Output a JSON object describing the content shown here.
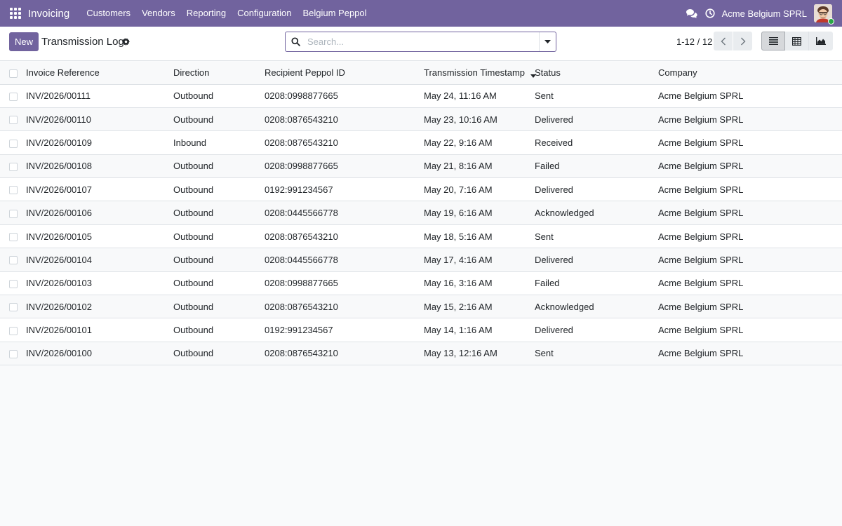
{
  "navbar": {
    "app_name": "Invoicing",
    "menu": [
      "Customers",
      "Vendors",
      "Reporting",
      "Configuration",
      "Belgium Peppol"
    ],
    "company": "Acme Belgium SPRL"
  },
  "control_panel": {
    "new_label": "New",
    "title": "Transmission Log",
    "search_placeholder": "Search...",
    "pager": "1-12 / 12"
  },
  "table": {
    "columns": [
      "Invoice Reference",
      "Direction",
      "Recipient Peppol ID",
      "Transmission Timestamp",
      "Status",
      "Company"
    ],
    "rows": [
      [
        "INV/2026/00111",
        "Outbound",
        "0208:0998877665",
        "May 24, 11:16 AM",
        "Sent",
        "Acme Belgium SPRL"
      ],
      [
        "INV/2026/00110",
        "Outbound",
        "0208:0876543210",
        "May 23, 10:16 AM",
        "Delivered",
        "Acme Belgium SPRL"
      ],
      [
        "INV/2026/00109",
        "Inbound",
        "0208:0876543210",
        "May 22, 9:16 AM",
        "Received",
        "Acme Belgium SPRL"
      ],
      [
        "INV/2026/00108",
        "Outbound",
        "0208:0998877665",
        "May 21, 8:16 AM",
        "Failed",
        "Acme Belgium SPRL"
      ],
      [
        "INV/2026/00107",
        "Outbound",
        "0192:991234567",
        "May 20, 7:16 AM",
        "Delivered",
        "Acme Belgium SPRL"
      ],
      [
        "INV/2026/00106",
        "Outbound",
        "0208:0445566778",
        "May 19, 6:16 AM",
        "Acknowledged",
        "Acme Belgium SPRL"
      ],
      [
        "INV/2026/00105",
        "Outbound",
        "0208:0876543210",
        "May 18, 5:16 AM",
        "Sent",
        "Acme Belgium SPRL"
      ],
      [
        "INV/2026/00104",
        "Outbound",
        "0208:0445566778",
        "May 17, 4:16 AM",
        "Delivered",
        "Acme Belgium SPRL"
      ],
      [
        "INV/2026/00103",
        "Outbound",
        "0208:0998877665",
        "May 16, 3:16 AM",
        "Failed",
        "Acme Belgium SPRL"
      ],
      [
        "INV/2026/00102",
        "Outbound",
        "0208:0876543210",
        "May 15, 2:16 AM",
        "Acknowledged",
        "Acme Belgium SPRL"
      ],
      [
        "INV/2026/00101",
        "Outbound",
        "0192:991234567",
        "May 14, 1:16 AM",
        "Delivered",
        "Acme Belgium SPRL"
      ],
      [
        "INV/2026/00100",
        "Outbound",
        "0208:0876543210",
        "May 13, 12:16 AM",
        "Sent",
        "Acme Belgium SPRL"
      ]
    ]
  },
  "colors": {
    "brand": "#71639e",
    "online": "#28a745"
  },
  "icons": [
    "apps-icon",
    "chat-icon",
    "clock-icon",
    "gear-icon",
    "search-icon",
    "chevron-down-icon",
    "chevron-left-icon",
    "chevron-right-icon",
    "list-view-icon",
    "pivot-view-icon",
    "graph-view-icon"
  ]
}
